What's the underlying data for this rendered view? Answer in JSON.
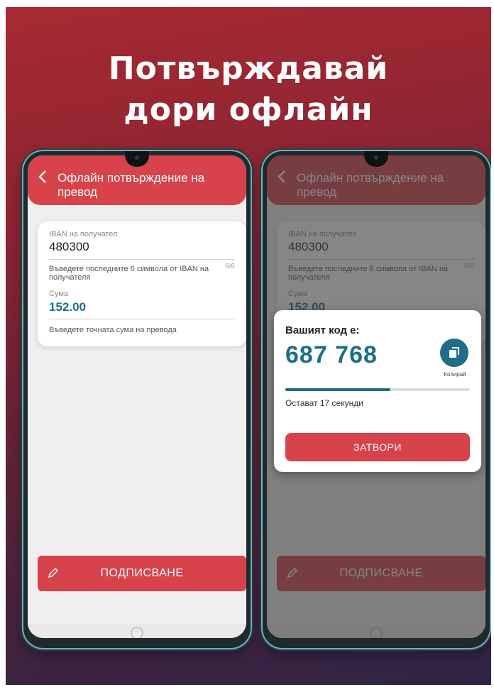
{
  "headline": {
    "line1": "Потвърждавай",
    "line2": "дори офлайн"
  },
  "screen": {
    "title": "Офлайн потвърждение на превод",
    "iban": {
      "label": "IBAN на получател",
      "value": "480300",
      "hint": "Въведете последните 6 символа от IBAN на получателя",
      "counter": "6/6"
    },
    "amount": {
      "label": "Сума",
      "value": "152.00",
      "hint": "Въведете точната сума на превода"
    },
    "sign_button": "ПОДПИСВАНЕ"
  },
  "modal": {
    "title": "Вашият код е:",
    "code": "687 768",
    "copy_label": "Копирай",
    "progress": 0.57,
    "timer_text": "Остават 17 секунди",
    "close_button": "ЗАТВОРИ"
  },
  "icons": {
    "back": "chevron-left-icon",
    "sign": "pencil-icon",
    "copy": "copy-icon"
  },
  "colors": {
    "accent_red": "#d8434b",
    "accent_teal": "#1d6e86",
    "screen_bg": "#efefef"
  }
}
